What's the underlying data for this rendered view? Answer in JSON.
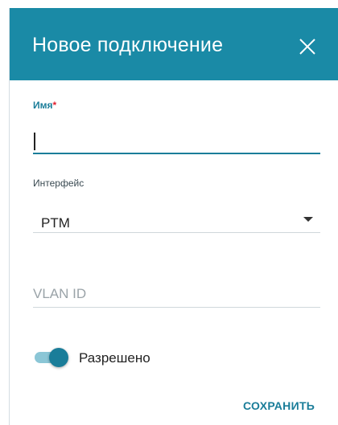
{
  "dialog": {
    "title": "Новое подключение",
    "close_icon": "close-icon"
  },
  "fields": {
    "name": {
      "label": "Имя",
      "required_mark": "*",
      "value": ""
    },
    "interface": {
      "label": "Интерфейс",
      "value": "PTM",
      "arrow_icon": "dropdown-arrow-icon"
    },
    "vlan": {
      "placeholder": "VLAN ID",
      "value": ""
    }
  },
  "toggle": {
    "label": "Разрешено",
    "state": "on"
  },
  "actions": {
    "save_label": "СОХРАНИТЬ"
  },
  "colors": {
    "header": "#1a8aa6",
    "accent": "#1a7d99",
    "track": "#8bc6d6"
  }
}
